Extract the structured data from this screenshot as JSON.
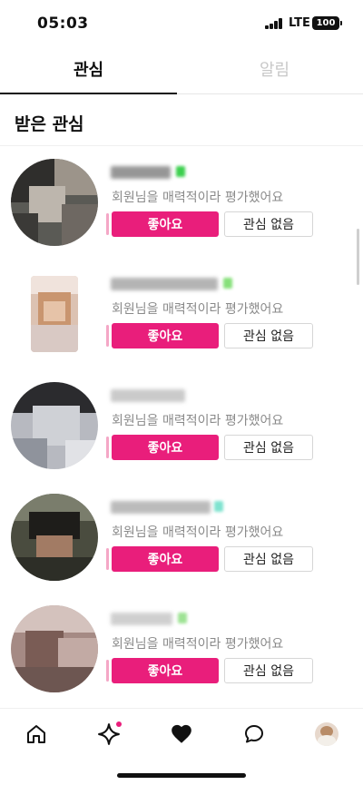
{
  "status": {
    "time": "05:03",
    "network": "LTE",
    "battery": "100"
  },
  "tabs": [
    {
      "label": "관심",
      "active": true
    },
    {
      "label": "알림",
      "active": false
    }
  ],
  "section": {
    "title": "받은 관심"
  },
  "items": [
    {
      "description": "회원님을 매력적이라 평가했어요",
      "like_label": "좋아요",
      "pass_label": "관심 없음"
    },
    {
      "description": "회원님을 매력적이라 평가했어요",
      "like_label": "좋아요",
      "pass_label": "관심 없음"
    },
    {
      "description": "회원님을 매력적이라 평가했어요",
      "like_label": "좋아요",
      "pass_label": "관심 없음"
    },
    {
      "description": "회원님을 매력적이라 평가했어요",
      "like_label": "좋아요",
      "pass_label": "관심 없음"
    },
    {
      "description": "회원님을 매력적이라 평가했어요",
      "like_label": "좋아요",
      "pass_label": "관심 없음"
    }
  ],
  "nav": {
    "items": [
      {
        "icon": "home-icon"
      },
      {
        "icon": "sparkle-icon",
        "has_notification_dot": true
      },
      {
        "icon": "heart-icon",
        "active": true
      },
      {
        "icon": "chat-bubble-icon"
      },
      {
        "icon": "profile-avatar"
      }
    ]
  },
  "colors": {
    "accent": "#e91e7b",
    "accent_light": "#f4a7c6",
    "inactive_tab": "#c8c8c8",
    "muted_text": "#8a8a8a"
  }
}
